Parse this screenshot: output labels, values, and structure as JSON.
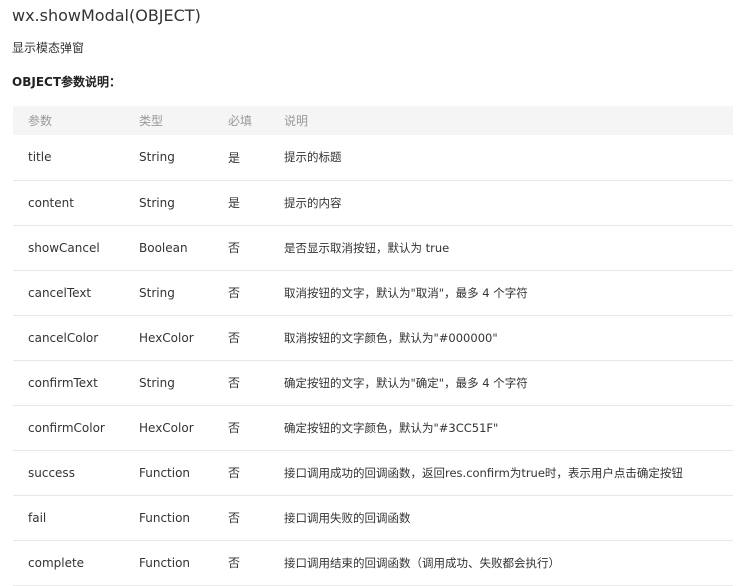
{
  "doc": {
    "title": "wx.showModal(OBJECT)",
    "description": "显示模态弹窗",
    "section_heading": "OBJECT参数说明："
  },
  "table": {
    "headers": [
      "参数",
      "类型",
      "必填",
      "说明"
    ],
    "rows": [
      {
        "param": "title",
        "type": "String",
        "required": "是",
        "desc": "提示的标题"
      },
      {
        "param": "content",
        "type": "String",
        "required": "是",
        "desc": "提示的内容"
      },
      {
        "param": "showCancel",
        "type": "Boolean",
        "required": "否",
        "desc": "是否显示取消按钮，默认为 true"
      },
      {
        "param": "cancelText",
        "type": "String",
        "required": "否",
        "desc": "取消按钮的文字，默认为\"取消\"，最多 4 个字符"
      },
      {
        "param": "cancelColor",
        "type": "HexColor",
        "required": "否",
        "desc": "取消按钮的文字颜色，默认为\"#000000\""
      },
      {
        "param": "confirmText",
        "type": "String",
        "required": "否",
        "desc": "确定按钮的文字，默认为\"确定\"，最多 4 个字符"
      },
      {
        "param": "confirmColor",
        "type": "HexColor",
        "required": "否",
        "desc": "确定按钮的文字颜色，默认为\"#3CC51F\""
      },
      {
        "param": "success",
        "type": "Function",
        "required": "否",
        "desc": "接口调用成功的回调函数，返回res.confirm为true时，表示用户点击确定按钮"
      },
      {
        "param": "fail",
        "type": "Function",
        "required": "否",
        "desc": "接口调用失败的回调函数"
      },
      {
        "param": "complete",
        "type": "Function",
        "required": "否",
        "desc": "接口调用结束的回调函数（调用成功、失败都会执行）"
      }
    ]
  }
}
